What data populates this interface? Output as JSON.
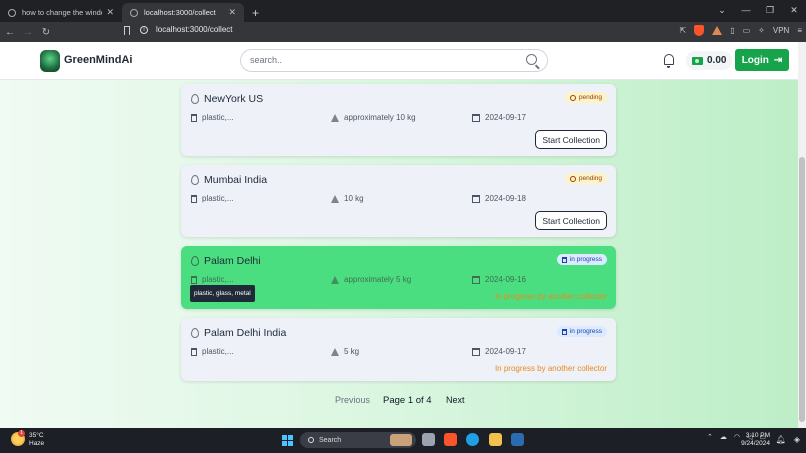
{
  "browser": {
    "tabs": [
      {
        "label": "how to change the window using lo",
        "active": false
      },
      {
        "label": "localhost:3000/collect",
        "active": true
      }
    ],
    "new_tab": "+",
    "url": "localhost:3000/collect",
    "vpn": "VPN",
    "controls": {
      "min": "—",
      "max": "❐",
      "close": "✕"
    }
  },
  "header": {
    "brand": "GreenMindAi",
    "search_placeholder": "search..",
    "balance": "0.00",
    "login_label": "Login"
  },
  "cards": [
    {
      "location": "NewYork US",
      "status": "pending",
      "waste": "plastic,...",
      "weight": "approximately 10 kg",
      "date": "2024-09-17",
      "action": "Start Collection"
    },
    {
      "location": "Mumbai India",
      "status": "pending",
      "waste": "plastic,...",
      "weight": "10 kg",
      "date": "2024-09-18",
      "action": "Start Collection"
    },
    {
      "location": "Palam Delhi",
      "status": "in progress",
      "waste": "plastic,...",
      "weight": "approximately 5 kg",
      "date": "2024-09-16",
      "note": "In progress by another collector",
      "tooltip": "plastic, glass, metal"
    },
    {
      "location": "Palam Delhi India",
      "status": "in progress",
      "waste": "plastic,...",
      "weight": "5 kg",
      "date": "2024-09-17",
      "note": "In progress by another collector"
    }
  ],
  "pagination": {
    "previous": "Previous",
    "page": "Page 1 of 4",
    "next": "Next"
  },
  "taskbar": {
    "temp": "35°C",
    "condition": "Haze",
    "alert_count": "1",
    "search_label": "Search",
    "time": "3:10 PM",
    "date": "9/24/2024"
  },
  "colors": {
    "accent": "#16a34a",
    "highlight_card": "#4ade80",
    "note": "#ea8a1c"
  }
}
